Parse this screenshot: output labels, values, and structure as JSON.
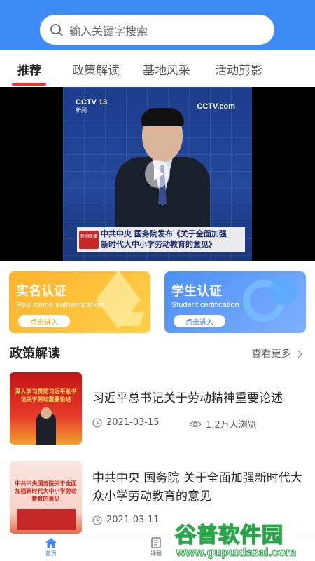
{
  "search": {
    "placeholder": "输入关键字搜索",
    "icon": "search-icon"
  },
  "tabs": [
    {
      "label": "推荐",
      "active": true
    },
    {
      "label": "政策解读",
      "active": false
    },
    {
      "label": "基地风采",
      "active": false
    },
    {
      "label": "活动剪影",
      "active": false
    }
  ],
  "video": {
    "channel_left": "CCTV 13",
    "channel_left_sub": "新闻",
    "channel_right": "CCTV.com",
    "caption_line1": "中共中央 国务院发布《关于全面加强",
    "caption_line2": "新时代大中小学劳动教育的意见》",
    "caption_badge": "新闻联播"
  },
  "cards": {
    "realname": {
      "title": "实名认证",
      "subtitle": "Real name authentication",
      "button": "点击进入",
      "color": "#ffb22b"
    },
    "student": {
      "title": "学生认证",
      "subtitle": "Student certification",
      "button": "点击进入",
      "color": "#4b8ff5"
    }
  },
  "section": {
    "title": "政策解读",
    "more": "查看更多"
  },
  "news": [
    {
      "title": "习近平总书记关于劳动精神重要论述",
      "date": "2021-03-15",
      "views": "1.2万人浏览",
      "thumb_text": "深入学习贯彻习近平总书记关于劳动重要论述"
    },
    {
      "title": "中共中央 国务院 关于全面加强新时代大众小学劳动教育的意见",
      "date": "2021-03-11",
      "views": "",
      "thumb_text": "中共中央国务院关于全面加强新时代大中小学劳动教育的意见"
    }
  ],
  "bottom_nav": [
    {
      "label": "首页",
      "icon": "home-icon",
      "active": true
    },
    {
      "label": "课程",
      "icon": "document-icon",
      "active": false
    }
  ],
  "watermark": {
    "main": "谷普软件园",
    "url": "www.gupuxlazal.com"
  },
  "colors": {
    "primary": "#3d8bf5",
    "accent_red": "#e53935",
    "card_yellow": "#ffb22b",
    "card_blue": "#4b8ff5"
  }
}
